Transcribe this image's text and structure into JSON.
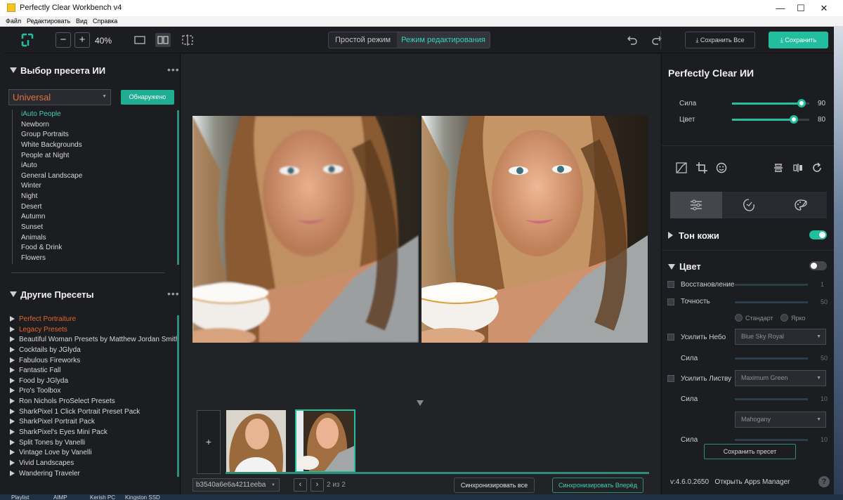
{
  "window": {
    "title": "Perfectly Clear Workbench v4",
    "minimize": "—",
    "maximize": "☐",
    "close": "✕"
  },
  "menu": [
    "Файл",
    "Редактировать",
    "Вид",
    "Справка"
  ],
  "toolbar": {
    "zoom": "40%",
    "zoom_out": "−",
    "zoom_in": "+",
    "mode_simple": "Простой режим",
    "mode_edit": "Режим редактирования",
    "save_all": "Сохранить Все",
    "save": "Сохранить"
  },
  "ai_presets": {
    "title": "Выбор пресета ИИ",
    "selected": "Universal",
    "detected_button": "Обнаружено",
    "items": [
      "iAuto People",
      "Newborn",
      "Group Portraits",
      "White Backgrounds",
      "People at Night",
      "iAuto",
      "General Landscape",
      "Winter",
      "Night",
      "Desert",
      "Autumn",
      "Sunset",
      "Animals",
      "Food & Drink",
      "Flowers"
    ]
  },
  "other_presets": {
    "title": "Другие Пресеты",
    "items": [
      "Perfect Portraiture",
      "Legacy Presets",
      "Beautiful Woman Presets by Matthew Jordan Smith",
      "Cocktails by JGlyda",
      "Fabulous Fireworks",
      "Fantastic Fall",
      "Food by JGlyda",
      "Pro's Toolbox",
      "Ron Nichols ProSelect Presets",
      "SharkPixel 1 Click Portrait Preset Pack",
      "SharkPixel Portrait Pack",
      "SharkPixel's Eyes Mini Pack",
      "Split Tones by Vanelli",
      "Vintage Love by Vanelli",
      "Vivid Landscapes",
      "Wandering Traveler"
    ],
    "highlighted": [
      0,
      1
    ]
  },
  "bottom": {
    "add_thumb": "+",
    "file_hash": "b3540a6e6a4211eeba",
    "pager": "2 из 2",
    "prev": "‹",
    "next": "›",
    "sync_all": "Синхронизировать все",
    "sync_forward": "Синхронизировать Вперёд"
  },
  "right": {
    "title": "Perfectly Clear ИИ",
    "strength_label": "Сила",
    "strength_value": "90",
    "strength_level": 0.9,
    "color_label": "Цвет",
    "color_value": "80",
    "color_level": 0.8,
    "skin_tone": "Тон кожи",
    "skin_tone_on": true,
    "color_section": "Цвет",
    "color_section_on": false,
    "restore": "Восстановление",
    "restore_value": "1",
    "accuracy": "Точность",
    "accuracy_value": "50",
    "radio_standard": "Стандарт",
    "radio_bright": "Ярко",
    "enhance_sky": "Усилить Небо",
    "sky_preset": "Blue Sky Royal",
    "sky_strength": "Сила",
    "sky_strength_value": "50",
    "enhance_foliage": "Усилить Листву",
    "foliage_preset": "Maximum Green",
    "foliage_strength": "Сила",
    "foliage_strength_value": "10",
    "third_preset": "Mahogany",
    "third_strength": "Сила",
    "third_strength_value": "10",
    "save_preset": "Сохранить пресет",
    "version": "v:4.6.0.2650",
    "apps_manager": "Открыть Apps Manager",
    "help": "?"
  },
  "taskbar": [
    "Playlist",
    "AIMP",
    "Kerish PC",
    "Kingston SSD"
  ],
  "colors": {
    "accent": "#21bf9d",
    "highlight": "#e2652c",
    "bg": "#1c1d21"
  }
}
